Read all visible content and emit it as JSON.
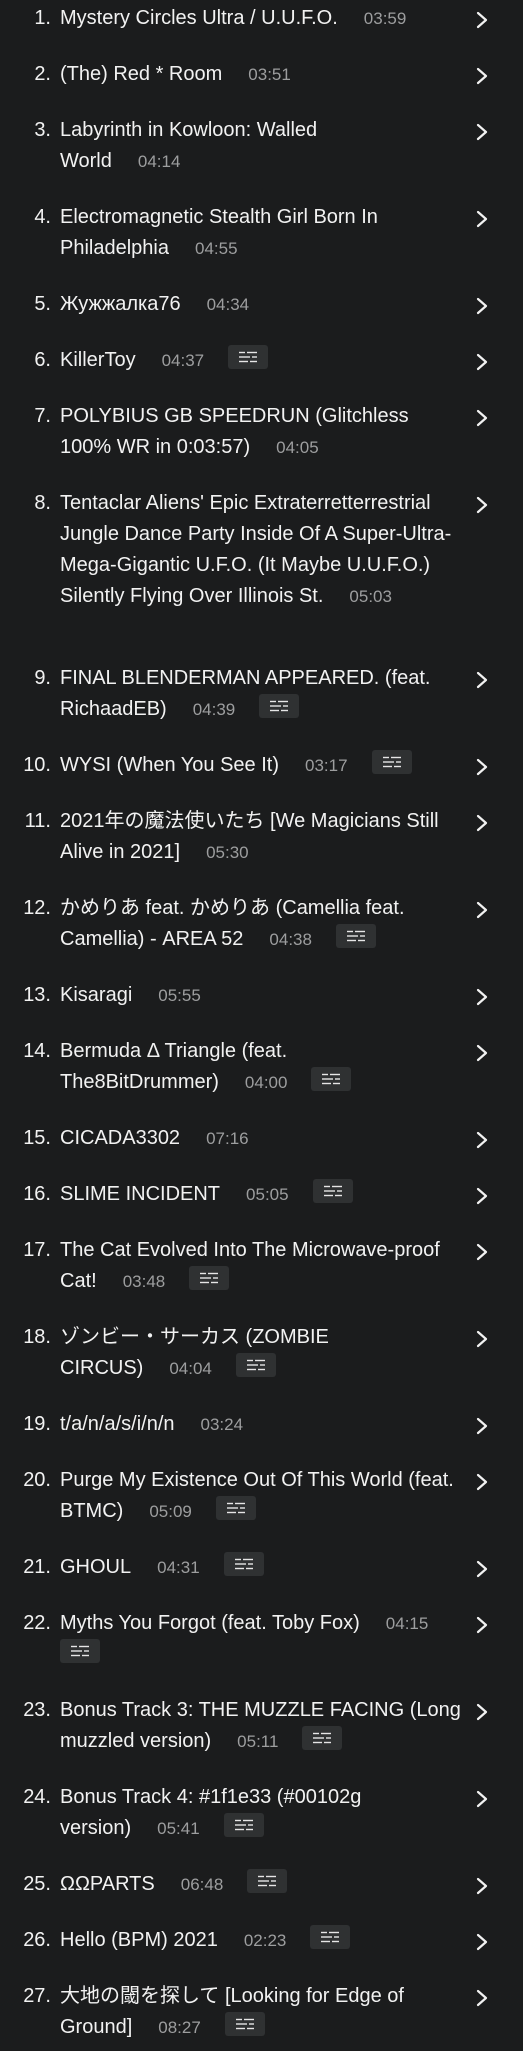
{
  "tracks": [
    {
      "num": "1.",
      "title": "Mystery Circles Ultra / U.U.F.O.",
      "duration": "03:59",
      "lyrics": false
    },
    {
      "num": "2.",
      "title": "(The) Red * Room",
      "duration": "03:51",
      "lyrics": false
    },
    {
      "num": "3.",
      "title": "Labyrinth in Kowloon: Walled World",
      "duration": "04:14",
      "lyrics": false
    },
    {
      "num": "4.",
      "title": "Electromagnetic Stealth Girl Born In Philadelphia",
      "duration": "04:55",
      "lyrics": false
    },
    {
      "num": "5.",
      "title": "Жужжалка76",
      "duration": "04:34",
      "lyrics": false
    },
    {
      "num": "6.",
      "title": "KillerToy",
      "duration": "04:37",
      "lyrics": true
    },
    {
      "num": "7.",
      "title": "POLYBIUS GB SPEEDRUN (Glitchless 100% WR in 0:03:57)",
      "duration": "04:05",
      "lyrics": false
    },
    {
      "num": "8.",
      "title": "Tentaclar Aliens' Epic Extraterretterrestrial Jungle Dance Party Inside Of A Super-Ultra-Mega-Gigantic U.F.O. (It Maybe U.U.F.O.) Silently Flying Over Illinois St.",
      "duration": "05:03",
      "lyrics": false
    },
    {
      "num": "9.",
      "title": "FINAL BLENDERMAN APPEARED. (feat. RichaadEB)",
      "duration": "04:39",
      "lyrics": true
    },
    {
      "num": "10.",
      "title": "WYSI (When You See It)",
      "duration": "03:17",
      "lyrics": true
    },
    {
      "num": "11.",
      "title": "2021年の魔法使いたち [We Magicians Still Alive in 2021]",
      "duration": "05:30",
      "lyrics": false
    },
    {
      "num": "12.",
      "title": "かめりあ feat. かめりあ (Camellia feat. Camellia) - AREA 52",
      "duration": "04:38",
      "lyrics": true
    },
    {
      "num": "13.",
      "title": "Kisaragi",
      "duration": "05:55",
      "lyrics": false
    },
    {
      "num": "14.",
      "title": "Bermuda Δ Triangle (feat. The8BitDrummer)",
      "duration": "04:00",
      "lyrics": true
    },
    {
      "num": "15.",
      "title": "CICADA3302",
      "duration": "07:16",
      "lyrics": false
    },
    {
      "num": "16.",
      "title": "SLIME INCIDENT",
      "duration": "05:05",
      "lyrics": true
    },
    {
      "num": "17.",
      "title": "The Cat Evolved Into The Microwave-proof Cat!",
      "duration": "03:48",
      "lyrics": true
    },
    {
      "num": "18.",
      "title": "ゾンビー・サーカス (ZOMBIE CIRCUS)",
      "duration": "04:04",
      "lyrics": true
    },
    {
      "num": "19.",
      "title": "t/a/n/a/s/i/n/n",
      "duration": "03:24",
      "lyrics": false
    },
    {
      "num": "20.",
      "title": "Purge My Existence Out Of This World (feat. BTMC)",
      "duration": "05:09",
      "lyrics": true
    },
    {
      "num": "21.",
      "title": "GHOUL",
      "duration": "04:31",
      "lyrics": true
    },
    {
      "num": "22.",
      "title": "Myths You Forgot (feat. Toby Fox)",
      "duration": "04:15",
      "lyrics": true
    },
    {
      "num": "23.",
      "title": "Bonus Track 3: THE MUZZLE FACING (Long muzzled version)",
      "duration": "05:11",
      "lyrics": true
    },
    {
      "num": "24.",
      "title": "Bonus Track 4: #1f1e33 (#00102g version)",
      "duration": "05:41",
      "lyrics": true
    },
    {
      "num": "25.",
      "title": "ΩΩPARTS",
      "duration": "06:48",
      "lyrics": true
    },
    {
      "num": "26.",
      "title": "Hello (BPM) 2021",
      "duration": "02:23",
      "lyrics": true
    },
    {
      "num": "27.",
      "title": "大地の閾を探して [Looking for Edge of Ground]",
      "duration": "08:27",
      "lyrics": true
    }
  ],
  "icons": {
    "lyrics": "lyrics-icon",
    "expand": "chevron-right-icon"
  },
  "colors": {
    "background": "#1b1c1d",
    "text": "#f2f2f2",
    "duration": "#9d9e9f",
    "lyrics_button": "#2f3132"
  }
}
